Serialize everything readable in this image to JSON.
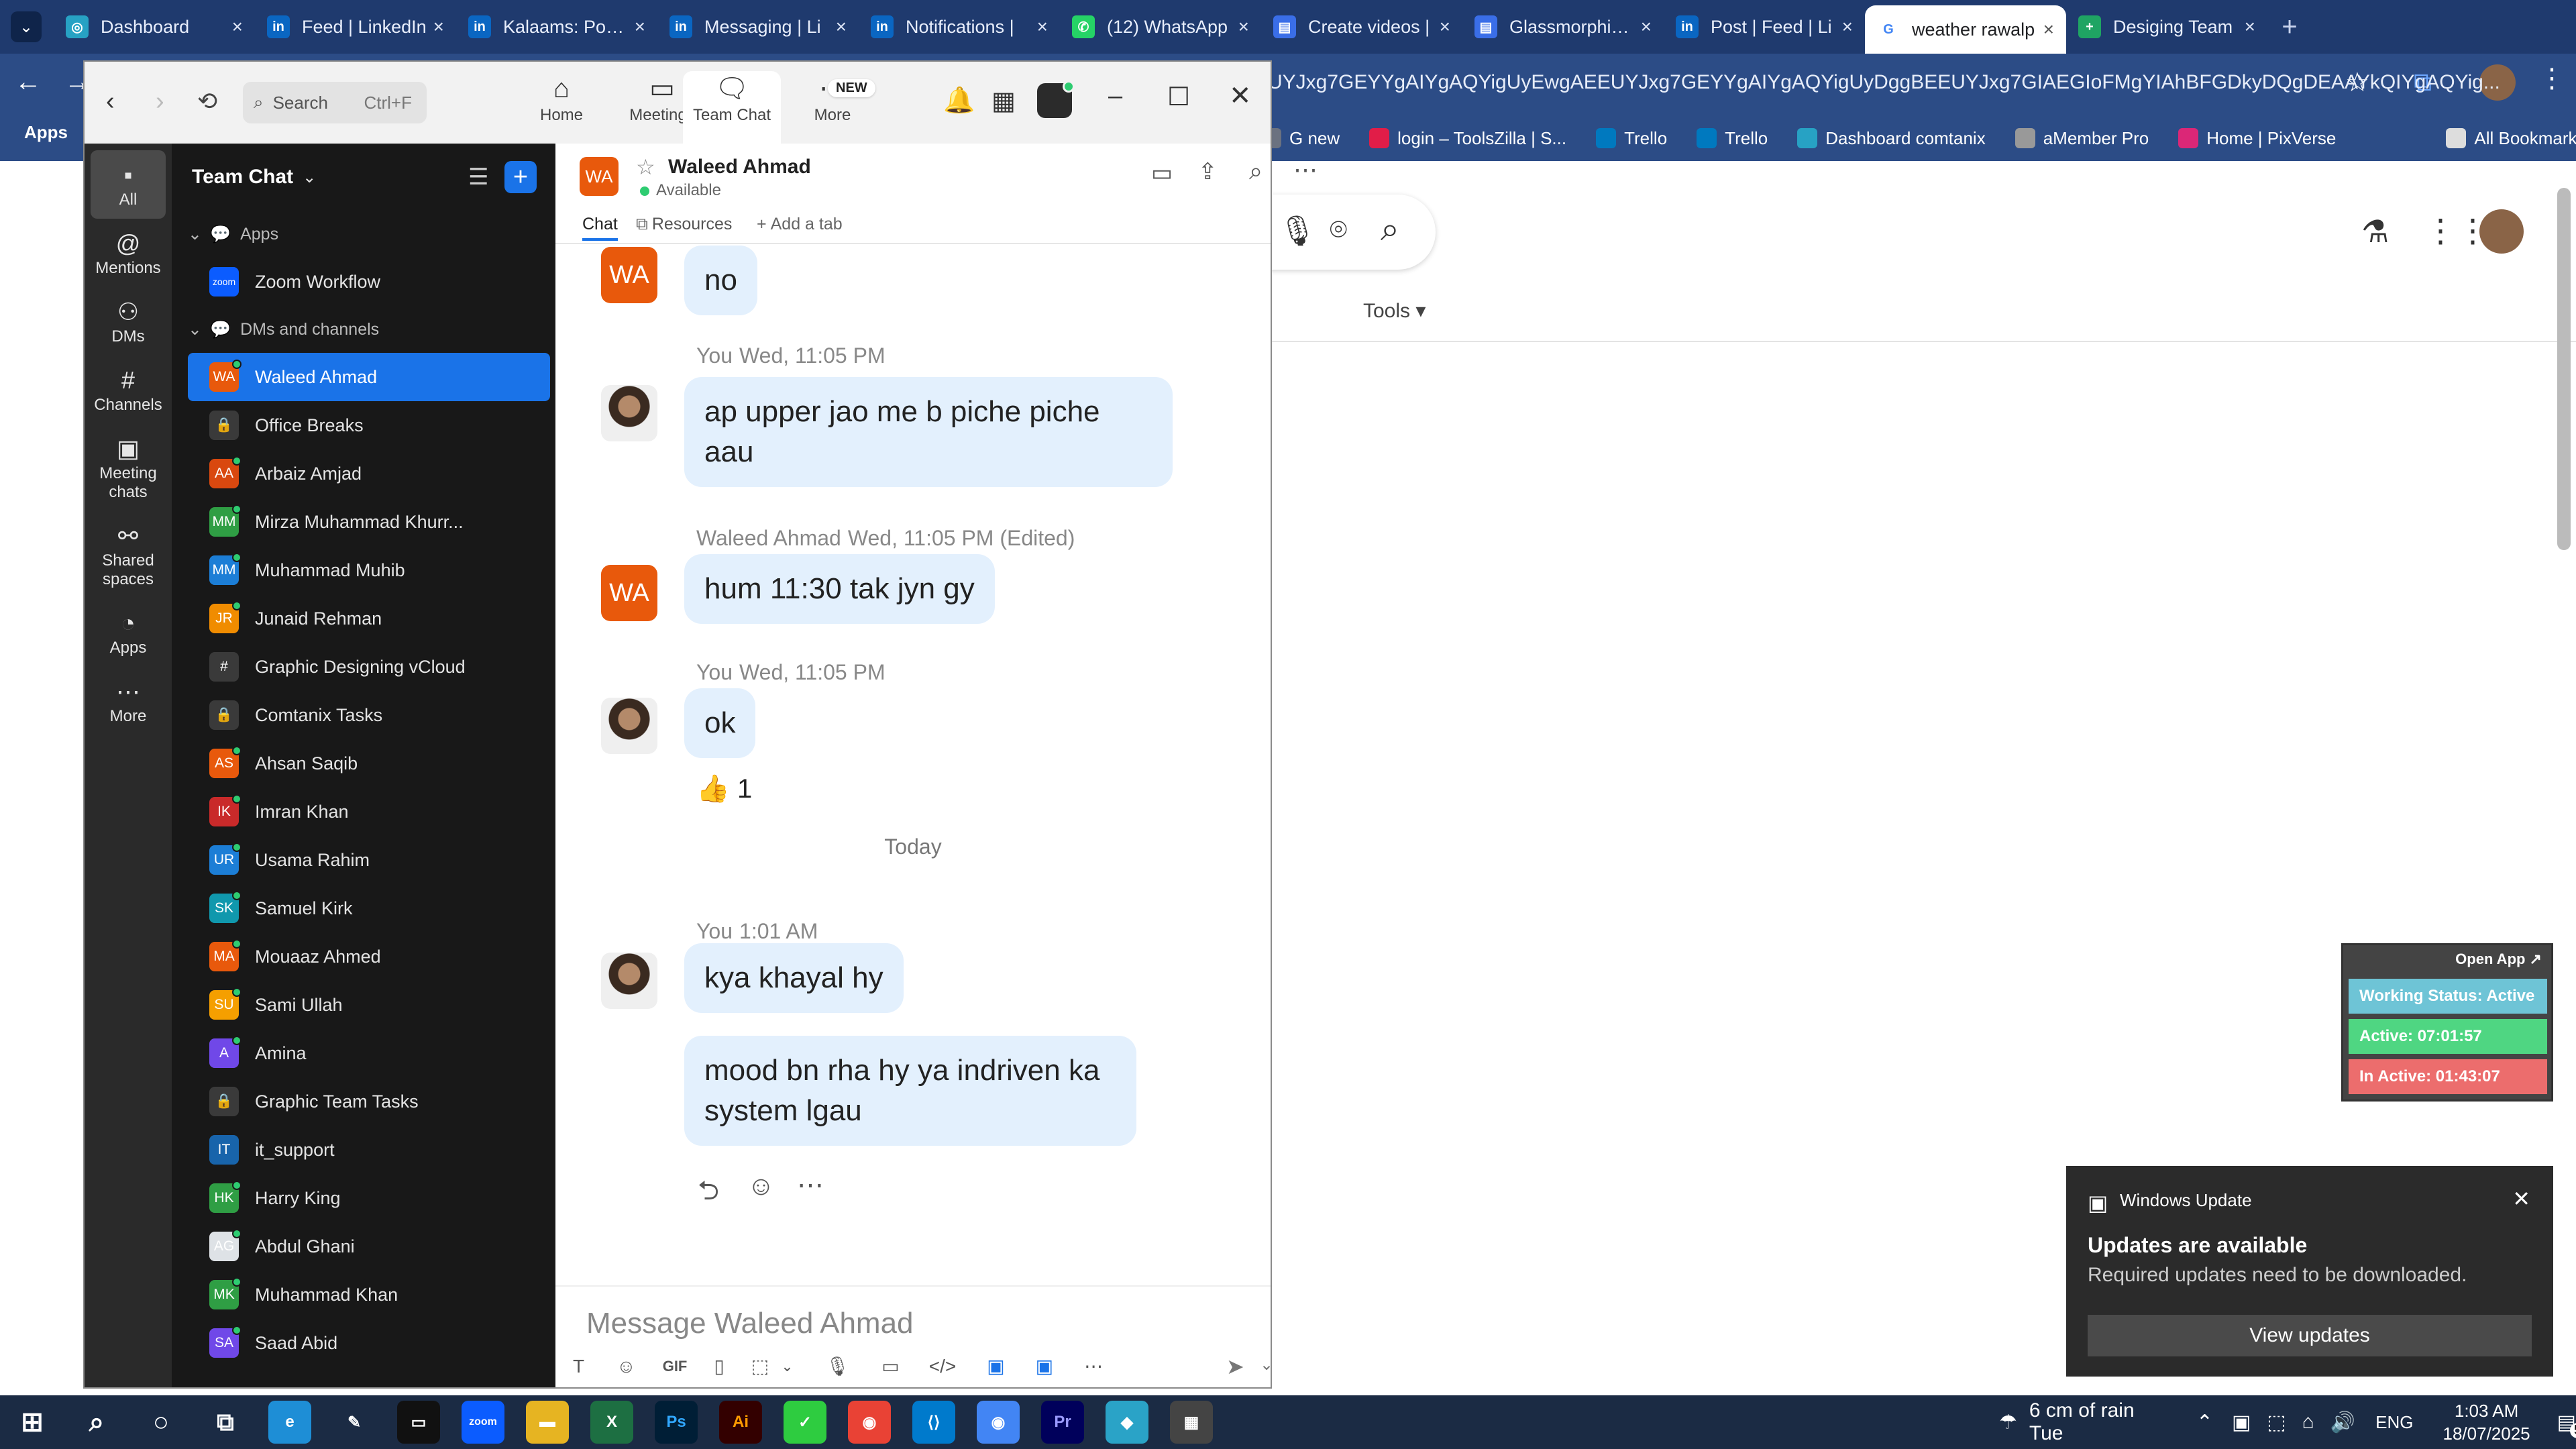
{
  "browser": {
    "tabs": [
      {
        "title": "Dashboard",
        "fav": "◎",
        "color": "#27a2c4"
      },
      {
        "title": "Feed | LinkedIn",
        "fav": "in",
        "color": "#0a66c2"
      },
      {
        "title": "Kalaams: Posts",
        "fav": "in",
        "color": "#0a66c2"
      },
      {
        "title": "Messaging | Li",
        "fav": "in",
        "color": "#0a66c2"
      },
      {
        "title": "Notifications |",
        "fav": "in",
        "color": "#0a66c2"
      },
      {
        "title": "(12) WhatsApp",
        "fav": "✆",
        "color": "#25d366"
      },
      {
        "title": "Create videos |",
        "fav": "▤",
        "color": "#3a6ee8"
      },
      {
        "title": "Glassmorphism",
        "fav": "▤",
        "color": "#3a6ee8"
      },
      {
        "title": "Post | Feed | Li",
        "fav": "in",
        "color": "#0a66c2"
      },
      {
        "title": "weather rawalp",
        "fav": "G",
        "color": "#fff"
      },
      {
        "title": "Desiging Team",
        "fav": "+",
        "color": "#1fa463"
      }
    ],
    "address_tail": "UYJxg7GEYYgAIYgAQYigUyEwgAEEUYJxg7GEYYgAIYgAQYigUyDggBEEUYJxg7GIAEGIoFMgYIAhBFGDkyDQgDEAAYkQIYgAQYig...",
    "bookmarks": [
      {
        "label": "G new",
        "color": "#6b7280"
      },
      {
        "label": "login – ToolsZilla | S...",
        "color": "#e11d48"
      },
      {
        "label": "Trello",
        "color": "#0079bf"
      },
      {
        "label": "Trello",
        "color": "#0079bf"
      },
      {
        "label": "Dashboard comtanix",
        "color": "#27a2c4"
      },
      {
        "label": "aMember Pro",
        "color": "#999"
      },
      {
        "label": "Home | PixVerse",
        "color": "#db2777"
      },
      {
        "label": "All Bookmarks",
        "color": "#ddd"
      }
    ],
    "apps_label": "Apps",
    "page_tools": "Tools ▾"
  },
  "zoom": {
    "search_placeholder": "Search",
    "search_shortcut": "Ctrl+F",
    "nav": {
      "home": "Home",
      "meetings": "Meetings",
      "team_chat": "Team Chat",
      "more": "More",
      "new_badge": "NEW"
    },
    "rail": [
      {
        "label": "All",
        "icon": "▪"
      },
      {
        "label": "Mentions",
        "icon": "@"
      },
      {
        "label": "DMs",
        "icon": "⚇"
      },
      {
        "label": "Channels",
        "icon": "#"
      },
      {
        "label": "Meeting chats",
        "icon": "▣"
      },
      {
        "label": "Shared spaces",
        "icon": "⚯"
      },
      {
        "label": "Apps",
        "icon": "◔"
      },
      {
        "label": "More",
        "icon": "⋯"
      }
    ],
    "sidebar": {
      "title": "Team Chat",
      "apps_section": "Apps",
      "app_item": "Zoom Workflow",
      "dms_section": "DMs and channels",
      "items": [
        {
          "name": "Waleed Ahmad",
          "initials": "WA",
          "color": "#e8590c",
          "selected": true
        },
        {
          "name": "Office Breaks",
          "initials": "🔒",
          "color": "#3a3a3a"
        },
        {
          "name": "Arbaiz Amjad",
          "initials": "AA",
          "color": "#d9480f"
        },
        {
          "name": "Mirza Muhammad Khurr...",
          "initials": "MM",
          "color": "#2f9e44"
        },
        {
          "name": "Muhammad Muhib",
          "initials": "MM",
          "color": "#1c7ed6"
        },
        {
          "name": "Junaid Rehman",
          "initials": "JR",
          "color": "#f08c00"
        },
        {
          "name": "Graphic Designing vCloud",
          "initials": "#",
          "color": "#3a3a3a"
        },
        {
          "name": "Comtanix Tasks",
          "initials": "🔒",
          "color": "#3a3a3a"
        },
        {
          "name": "Ahsan Saqib",
          "initials": "AS",
          "color": "#e8590c"
        },
        {
          "name": "Imran Khan",
          "initials": "IK",
          "color": "#c92a2a"
        },
        {
          "name": "Usama Rahim",
          "initials": "UR",
          "color": "#1c7ed6"
        },
        {
          "name": "Samuel Kirk",
          "initials": "SK",
          "color": "#1098ad"
        },
        {
          "name": "Mouaaz Ahmed",
          "initials": "MA",
          "color": "#e8590c"
        },
        {
          "name": "Sami Ullah",
          "initials": "SU",
          "color": "#f59f00"
        },
        {
          "name": "Amina",
          "initials": "A",
          "color": "#7048e8"
        },
        {
          "name": "Graphic Team Tasks",
          "initials": "🔒",
          "color": "#3a3a3a"
        },
        {
          "name": "it_support",
          "initials": "IT",
          "color": "#1864ab"
        },
        {
          "name": "Harry King",
          "initials": "HK",
          "color": "#2f9e44"
        },
        {
          "name": "Abdul Ghani",
          "initials": "AG",
          "color": "#dee2e6"
        },
        {
          "name": "Muhammad Khan",
          "initials": "MK",
          "color": "#2f9e44"
        },
        {
          "name": "Saad Abid",
          "initials": "SA",
          "color": "#7048e8"
        }
      ]
    },
    "chat": {
      "contact": "Waleed Ahmad",
      "contact_initials": "WA",
      "status": "Available",
      "tabs": {
        "chat": "Chat",
        "resources": "Resources",
        "add": "Add a tab"
      },
      "messages": {
        "m1": "no",
        "s2": "You",
        "t2": "Wed, 11:05 PM",
        "m2a": "ap upper jao me b piche piche",
        "m2b": "aau",
        "s3": "Waleed Ahmad",
        "t3": "Wed, 11:05 PM (Edited)",
        "m3": "hum 11:30  tak jyn gy",
        "s4": "You",
        "t4": "Wed, 11:05 PM",
        "m4": "ok",
        "reaction": "👍",
        "reaction_count": "1",
        "divider": "Today",
        "s5": "You",
        "t5": "1:01 AM",
        "m5": "kya khayal hy",
        "m6a": "mood bn rha hy ya indriven ka",
        "m6b": "system lgau"
      },
      "composer_placeholder": "Message Waleed Ahmad",
      "composer_gif": "GIF"
    }
  },
  "widget": {
    "open_app": "Open App ↗",
    "status": "Working Status: Active",
    "active": "Active: 07:01:57",
    "inactive": "In Active: 01:43:07"
  },
  "win_update": {
    "app": "Windows Update",
    "title": "Updates are available",
    "body": "Required updates need to be downloaded.",
    "button": "View updates"
  },
  "taskbar": {
    "weather": "6 cm of rain Tue",
    "lang": "ENG",
    "time": "1:03 AM",
    "date": "18/07/2025",
    "notif_count": "5"
  }
}
